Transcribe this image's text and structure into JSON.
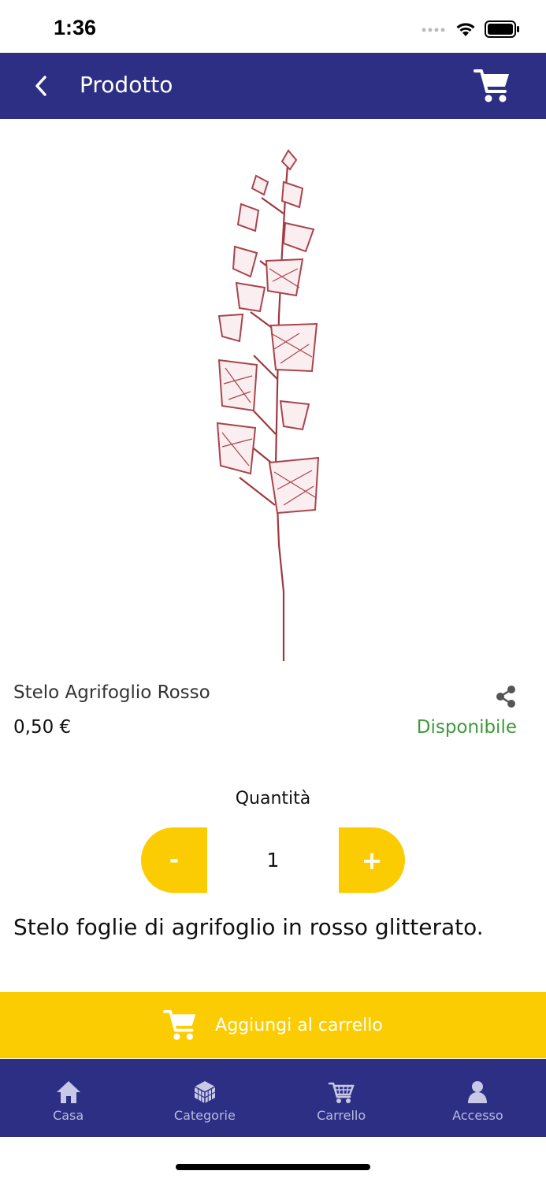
{
  "status_bar": {
    "time": "1:36"
  },
  "header": {
    "title": "Prodotto"
  },
  "product": {
    "name": "Stelo Agrifoglio Rosso",
    "price": "0,50 €",
    "availability": "Disponibile",
    "description": "Stelo foglie di agrifoglio in rosso glitterato."
  },
  "quantity": {
    "label": "Quantità",
    "value": "1",
    "minus": "-",
    "plus": "+"
  },
  "add_to_cart": {
    "label": "Aggiungi al carrello"
  },
  "tabs": [
    {
      "label": "Casa",
      "icon": "home-icon"
    },
    {
      "label": "Categorie",
      "icon": "cube-icon"
    },
    {
      "label": "Carrello",
      "icon": "cart-icon"
    },
    {
      "label": "Accesso",
      "icon": "user-icon"
    }
  ],
  "colors": {
    "primary": "#2d2f85",
    "accent": "#fccc03",
    "available": "#3e9a3c"
  }
}
